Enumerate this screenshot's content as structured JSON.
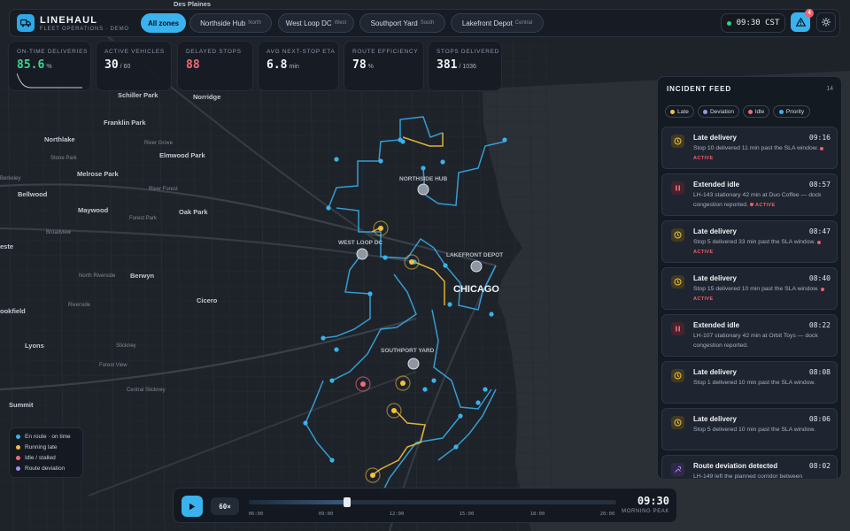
{
  "brand": {
    "name": "LINEHAUL",
    "subtitle": "FLEET OPERATIONS · DEMO"
  },
  "zones": [
    {
      "label": "All zones",
      "sub": "",
      "active": true
    },
    {
      "label": "Northside Hub",
      "sub": "North",
      "active": false
    },
    {
      "label": "West Loop DC",
      "sub": "West",
      "active": false
    },
    {
      "label": "Southport Yard",
      "sub": "South",
      "active": false
    },
    {
      "label": "Lakefront Depot",
      "sub": "Central",
      "active": false
    }
  ],
  "clock": {
    "time": "09:30",
    "tz": "CST"
  },
  "alerts": {
    "count": "4"
  },
  "kpis": [
    {
      "label": "ON-TIME DELIVERIES",
      "value": "85.6",
      "unit": "%",
      "color": "#3fd68a"
    },
    {
      "label": "ACTIVE VEHICLES",
      "value": "30",
      "unit": "/ 60",
      "color": "#f1f4f8"
    },
    {
      "label": "DELAYED STOPS",
      "value": "88",
      "unit": "",
      "color": "#f06a7a"
    },
    {
      "label": "AVG NEXT-STOP ETA",
      "value": "6.8",
      "unit": "min",
      "color": "#f1f4f8"
    },
    {
      "label": "ROUTE EFFICIENCY",
      "value": "78",
      "unit": "%",
      "color": "#f1f4f8"
    },
    {
      "label": "STOPS DELIVERED",
      "value": "381",
      "unit": "/ 1036",
      "color": "#f1f4f8"
    }
  ],
  "map": {
    "places": [
      {
        "name": "Des Plaines",
        "size": "s"
      },
      {
        "name": "Schiller Park",
        "size": "s"
      },
      {
        "name": "Norridge",
        "size": "s"
      },
      {
        "name": "Franklin Park",
        "size": "s"
      },
      {
        "name": "Northlake",
        "size": "s"
      },
      {
        "name": "River Grove",
        "size": "xs"
      },
      {
        "name": "Stone Park",
        "size": "xs"
      },
      {
        "name": "Elmwood Park",
        "size": "s"
      },
      {
        "name": "Berkeley",
        "size": "xs"
      },
      {
        "name": "Melrose Park",
        "size": "s"
      },
      {
        "name": "Bellwood",
        "size": "s"
      },
      {
        "name": "River Forest",
        "size": "xs"
      },
      {
        "name": "Maywood",
        "size": "s"
      },
      {
        "name": "Forest Park",
        "size": "xs"
      },
      {
        "name": "Oak Park",
        "size": "s"
      },
      {
        "name": "Broadview",
        "size": "xs"
      },
      {
        "name": "este",
        "size": "s"
      },
      {
        "name": "North Riverside",
        "size": "xs"
      },
      {
        "name": "Berwyn",
        "size": "s"
      },
      {
        "name": "Cicero",
        "size": "s"
      },
      {
        "name": "Riverside",
        "size": "xs"
      },
      {
        "name": "ookfield",
        "size": "s"
      },
      {
        "name": "Lyons",
        "size": "s"
      },
      {
        "name": "Stickney",
        "size": "xs"
      },
      {
        "name": "Forest View",
        "size": "xs"
      },
      {
        "name": "Central Stickney",
        "size": "xs"
      },
      {
        "name": "Summit",
        "size": "s"
      },
      {
        "name": "CHICAGO",
        "size": "city"
      }
    ],
    "depots": [
      "NORTHSIDE HUB",
      "WEST LOOP DC",
      "LAKEFRONT DEPOT",
      "SOUTHPORT YARD"
    ]
  },
  "feed": {
    "title": "INCIDENT FEED",
    "count": "14",
    "filters": [
      {
        "label": "Late",
        "color": "#f3c23a"
      },
      {
        "label": "Deviation",
        "color": "#a98cf0"
      },
      {
        "label": "Idle",
        "color": "#f06a7a"
      },
      {
        "label": "Priority",
        "color": "#39b2ee"
      }
    ],
    "items": [
      {
        "type": "late",
        "title": "Late delivery",
        "time": "09:16",
        "desc": "Stop 10 delivered 11 min past the SLA window.",
        "active": "ACTIVE"
      },
      {
        "type": "idle",
        "title": "Extended idle",
        "time": "08:57",
        "desc": "LH-143 stationary 42 min at Duo Coffee — dock congestion reported.",
        "active": "ACTIVE"
      },
      {
        "type": "late",
        "title": "Late delivery",
        "time": "08:47",
        "desc": "Stop 5 delivered 33 min past the SLA window.",
        "active": "ACTIVE"
      },
      {
        "type": "late",
        "title": "Late delivery",
        "time": "08:40",
        "desc": "Stop 15 delivered 10 min past the SLA window.",
        "active": "ACTIVE"
      },
      {
        "type": "idle",
        "title": "Extended idle",
        "time": "08:22",
        "desc": "LH-107 stationary 42 min at Orbit Toys — dock congestion reported.",
        "active": ""
      },
      {
        "type": "late",
        "title": "Late delivery",
        "time": "08:08",
        "desc": "Stop 1 delivered 10 min past the SLA window.",
        "active": ""
      },
      {
        "type": "late",
        "title": "Late delivery",
        "time": "08:06",
        "desc": "Stop 5 delivered 10 min past the SLA window.",
        "active": ""
      },
      {
        "type": "deviation",
        "title": "Route deviation detected",
        "time": "08:02",
        "desc": "LH-149 left the planned corridor between",
        "active": ""
      }
    ]
  },
  "legend": [
    {
      "label": "En route · on time",
      "color": "#39b2ee"
    },
    {
      "label": "Running late",
      "color": "#f3c23a"
    },
    {
      "label": "Idle / stalled",
      "color": "#f06a7a"
    },
    {
      "label": "Route deviation",
      "color": "#a98cf0"
    }
  ],
  "playback": {
    "speed": "60×",
    "time": "09:30",
    "phase": "MORNING PEAK",
    "ticks": [
      "06:00",
      "09:00",
      "12:00",
      "15:00",
      "18:00",
      "20:00"
    ],
    "progress": 0.268,
    "colors": {
      "accent": "#39b2ee",
      "late": "#f3c23a",
      "idle": "#f06a7a",
      "deviation": "#a98cf0"
    }
  }
}
